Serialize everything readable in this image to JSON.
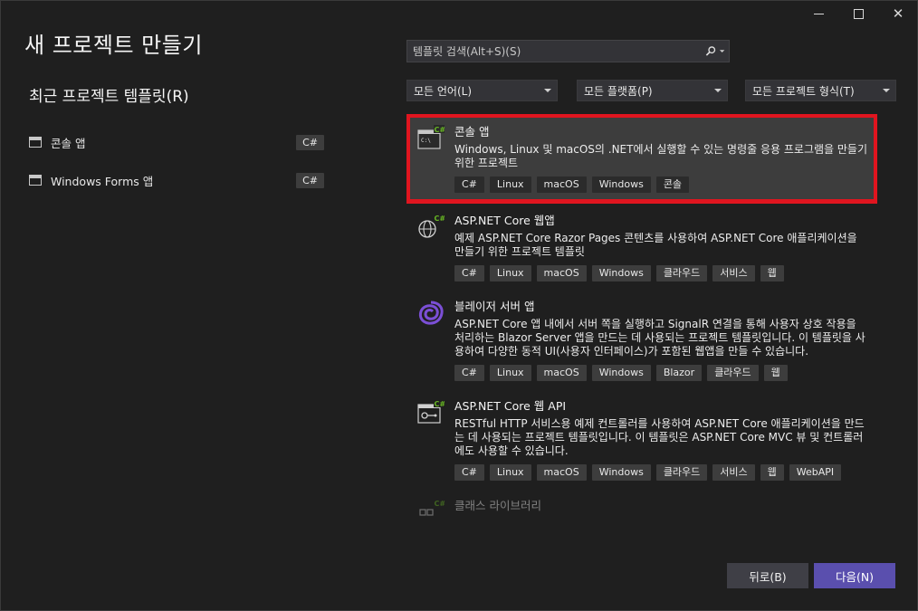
{
  "window": {
    "title": "새 프로젝트 만들기",
    "controls": {
      "close": "✕"
    }
  },
  "recent": {
    "heading": "최근 프로젝트 템플릿(R)",
    "items": [
      {
        "label": "콘솔 앱",
        "lang": "C#"
      },
      {
        "label": "Windows Forms 앱",
        "lang": "C#"
      }
    ]
  },
  "search": {
    "placeholder": "템플릿 검색(Alt+S)(S)",
    "icon": "search-icon"
  },
  "filters": {
    "language": "모든 언어(L)",
    "platform": "모든 플랫폼(P)",
    "project_type": "모든 프로젝트 형식(T)"
  },
  "templates": [
    {
      "name": "콘솔 앱",
      "description": "Windows, Linux 및 macOS의 .NET에서 실행할 수 있는 명령줄 응용 프로그램을 만들기 위한 프로젝트",
      "tags": [
        "C#",
        "Linux",
        "macOS",
        "Windows",
        "콘솔"
      ],
      "icon": "console-app-icon",
      "icon_badge": "C#",
      "icon_text": "C:\\",
      "selected": true
    },
    {
      "name": "ASP.NET Core 웹앱",
      "description": "예제 ASP.NET Core Razor Pages 콘텐츠를 사용하여 ASP.NET Core 애플리케이션을 만들기 위한 프로젝트 템플릿",
      "tags": [
        "C#",
        "Linux",
        "macOS",
        "Windows",
        "클라우드",
        "서비스",
        "웹"
      ],
      "icon": "globe-web-icon",
      "icon_badge": "C#"
    },
    {
      "name": "블레이저 서버 앱",
      "description": "ASP.NET Core 앱 내에서 서버 쪽을 실행하고 SignalR 연결을 통해 사용자 상호 작용을 처리하는 Blazor Server 앱을 만드는 데 사용되는 프로젝트 템플릿입니다. 이 템플릿을 사용하여 다양한 동적 UI(사용자 인터페이스)가 포함된 웹앱을 만들 수 있습니다.",
      "tags": [
        "C#",
        "Linux",
        "macOS",
        "Windows",
        "Blazor",
        "클라우드",
        "웹"
      ],
      "icon": "blazor-icon"
    },
    {
      "name": "ASP.NET Core 웹 API",
      "description": "RESTful HTTP 서비스용 예제 컨트롤러를 사용하여 ASP.NET Core 애플리케이션을 만드는 데 사용되는 프로젝트 템플릿입니다. 이 템플릿은 ASP.NET Core MVC 뷰 및 컨트롤러에도 사용할 수 있습니다.",
      "tags": [
        "C#",
        "Linux",
        "macOS",
        "Windows",
        "클라우드",
        "서비스",
        "웹",
        "WebAPI"
      ],
      "icon": "web-api-icon",
      "icon_badge": "C#"
    },
    {
      "name": "클래스 라이브러리",
      "description": "",
      "tags": [],
      "icon": "class-library-icon",
      "icon_badge": "C#"
    }
  ],
  "buttons": {
    "back": "뒤로(B)",
    "next": "다음(N)"
  },
  "colors": {
    "accent": "#5a4fae",
    "selection_outline": "#e0151f",
    "csharp_badge": "#68b723",
    "blazor": "#7b4fd6"
  }
}
